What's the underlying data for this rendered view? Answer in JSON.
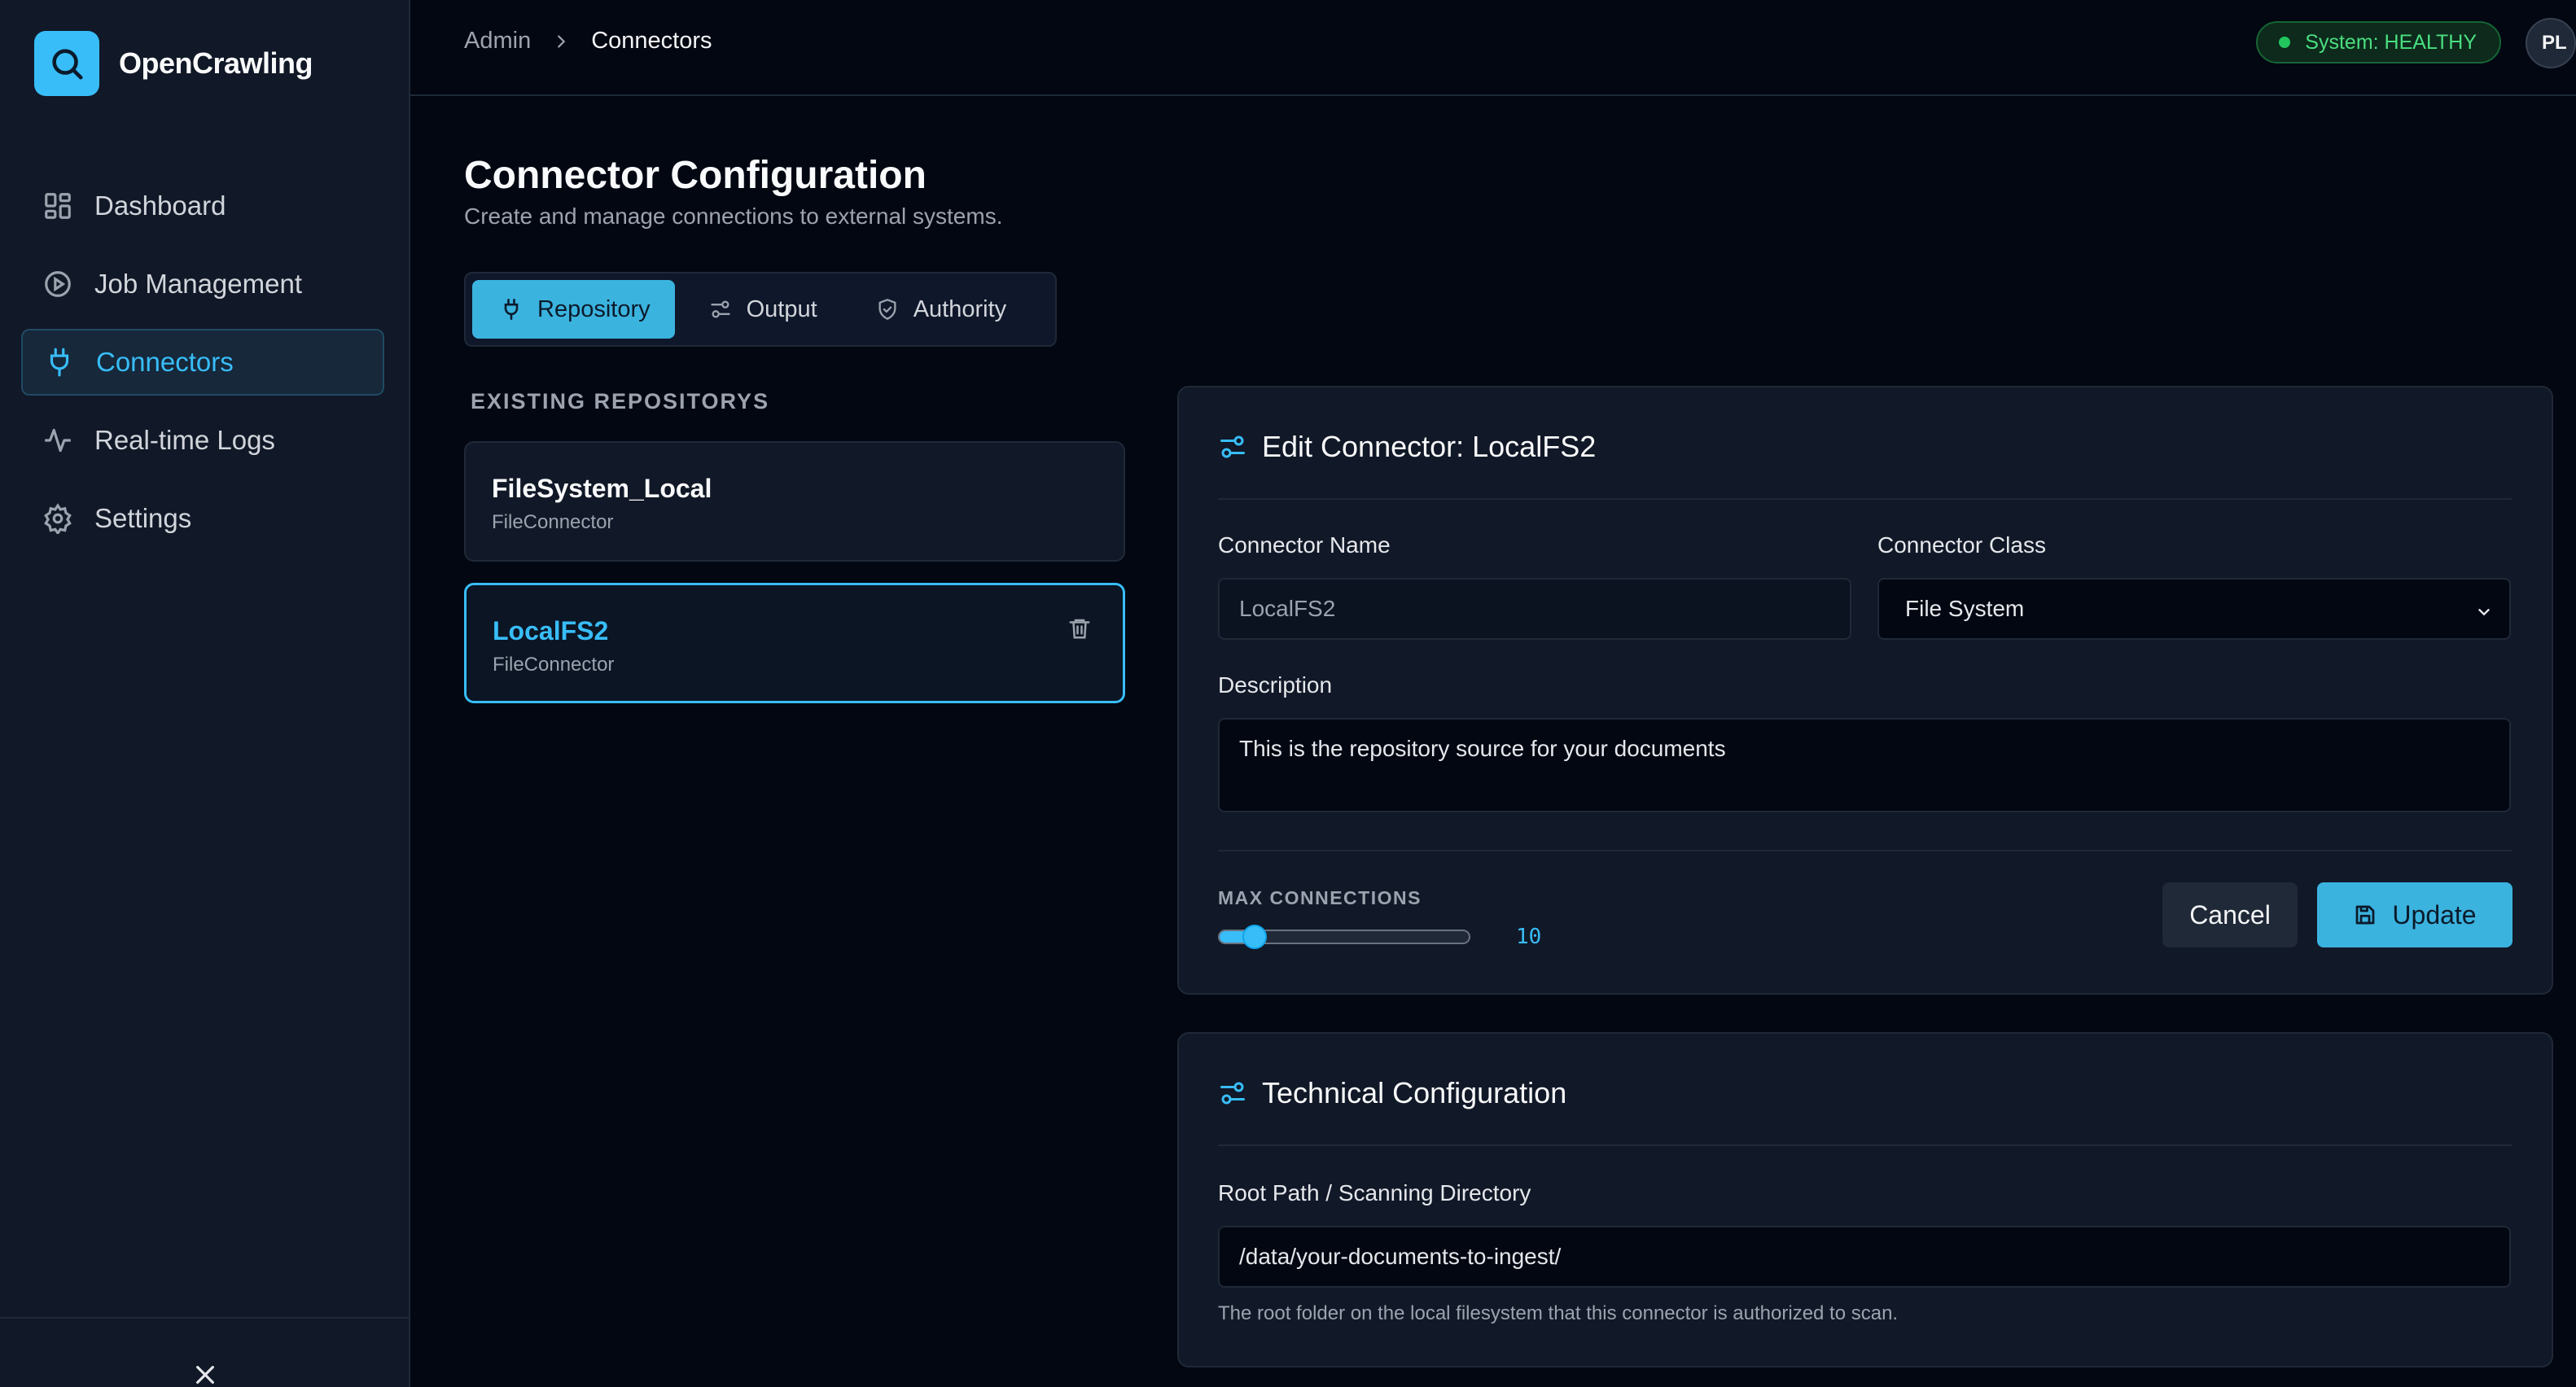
{
  "app": {
    "name": "OpenCrawling"
  },
  "sidebar": {
    "items": [
      {
        "label": "Dashboard",
        "icon": "dashboard-icon"
      },
      {
        "label": "Job Management",
        "icon": "play-circle-icon"
      },
      {
        "label": "Connectors",
        "icon": "plug-icon",
        "active": true
      },
      {
        "label": "Real-time Logs",
        "icon": "activity-icon"
      },
      {
        "label": "Settings",
        "icon": "gear-icon"
      }
    ]
  },
  "header": {
    "breadcrumb": [
      "Admin",
      "Connectors"
    ],
    "status": "System: HEALTHY",
    "avatar_initials": "PL"
  },
  "page": {
    "title": "Connector Configuration",
    "subtitle": "Create and manage connections to external systems."
  },
  "tabs": [
    {
      "label": "Repository",
      "active": true
    },
    {
      "label": "Output"
    },
    {
      "label": "Authority"
    }
  ],
  "repositories": {
    "section_label": "EXISTING REPOSITORYS",
    "items": [
      {
        "name": "FileSystem_Local",
        "class": "FileConnector",
        "selected": false
      },
      {
        "name": "LocalFS2",
        "class": "FileConnector",
        "selected": true
      }
    ]
  },
  "edit_panel": {
    "title": "Edit Connector: LocalFS2",
    "name_label": "Connector Name",
    "name_value": "LocalFS2",
    "class_label": "Connector Class",
    "class_value": "File System",
    "description_label": "Description",
    "description_value": "This is the repository source for your documents",
    "max_connections_label": "MAX CONNECTIONS",
    "max_connections_value": "10",
    "max_connections_fraction": 0.1,
    "cancel_label": "Cancel",
    "update_label": "Update"
  },
  "tech_panel": {
    "title": "Technical Configuration",
    "root_path_label": "Root Path / Scanning Directory",
    "root_path_value": "/data/your-documents-to-ingest/",
    "root_path_help": "The root folder on the local filesystem that this connector is authorized to scan."
  },
  "colors": {
    "accent": "#38bdf8",
    "background": "#030712",
    "sidebar": "#111827",
    "healthy": "#4ade80"
  }
}
